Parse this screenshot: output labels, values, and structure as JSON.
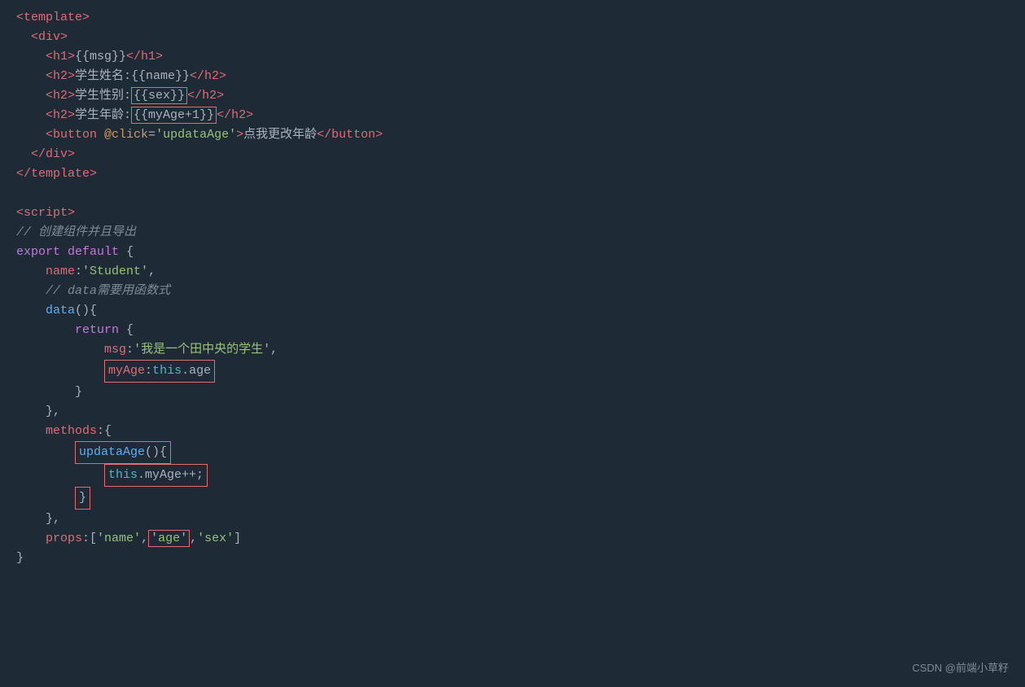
{
  "watermark": "CSDN @前端小草籽",
  "lines": [
    {
      "id": "l1",
      "content": "<template>"
    },
    {
      "id": "l2",
      "content": "  <div>"
    },
    {
      "id": "l3",
      "content": "    <h1>{{msg}}</h1>"
    },
    {
      "id": "l4",
      "content": "    <h2>学生姓名:{{name}}</h2>"
    },
    {
      "id": "l5",
      "content": "    <h2>学生性别:{{sex}}</h2>"
    },
    {
      "id": "l6",
      "content": "    <h2>学生年龄:{{myAge+1}}</h2>"
    },
    {
      "id": "l7",
      "content": "    <button @click='updataAge'>点我更改年龄</button>"
    },
    {
      "id": "l8",
      "content": "  </div>"
    },
    {
      "id": "l9",
      "content": "</template>"
    },
    {
      "id": "l10",
      "content": ""
    },
    {
      "id": "l11",
      "content": "<script>"
    },
    {
      "id": "l12",
      "content": "// 创建组件并且导出"
    },
    {
      "id": "l13",
      "content": "export default {"
    },
    {
      "id": "l14",
      "content": "    name:'Student',"
    },
    {
      "id": "l15",
      "content": "    // data需要用函数式"
    },
    {
      "id": "l16",
      "content": "    data(){"
    },
    {
      "id": "l17",
      "content": "        return {"
    },
    {
      "id": "l18",
      "content": "            msg:'我是一个田中央的学生',"
    },
    {
      "id": "l19",
      "content": "            myAge:this.age"
    },
    {
      "id": "l20",
      "content": "        }"
    },
    {
      "id": "l21",
      "content": "    },"
    },
    {
      "id": "l22",
      "content": "    methods:{"
    },
    {
      "id": "l23",
      "content": "        updataAge(){"
    },
    {
      "id": "l24",
      "content": "            this.myAge++;"
    },
    {
      "id": "l25",
      "content": "        }"
    },
    {
      "id": "l26",
      "content": "    },"
    },
    {
      "id": "l27",
      "content": "    props:['name','age','sex']"
    },
    {
      "id": "l28",
      "content": "}"
    }
  ]
}
